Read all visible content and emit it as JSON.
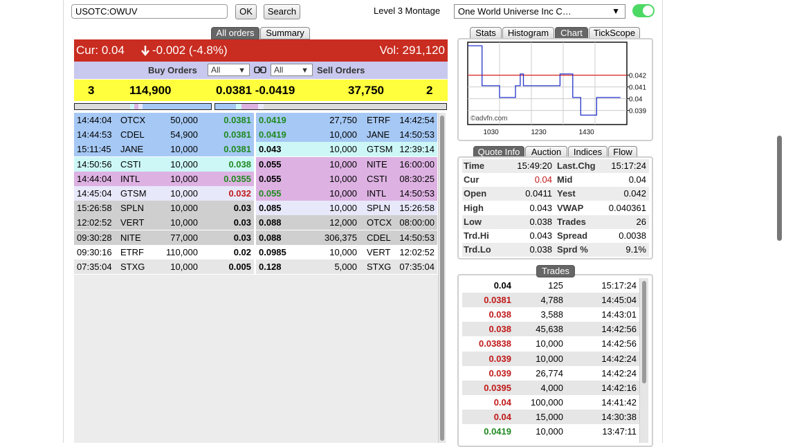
{
  "toolbar": {
    "symbol_value": "USOTC:OWUV",
    "ok_label": "OK",
    "search_label": "Search",
    "montage_label": "Level 3 Montage",
    "company_selected": "One World Universe Inc C…"
  },
  "left_tabs": [
    "All orders",
    "Summary"
  ],
  "price_bar": {
    "cur": "Cur: 0.04",
    "change": "-0.002 (-4.8%)",
    "vol": "Vol: 291,120"
  },
  "orders_header": {
    "buy_label": "Buy Orders",
    "sell_label": "Sell Orders",
    "buy_filter": "All",
    "sell_filter": "All"
  },
  "summary": {
    "buy_count": "3",
    "buy_size": "114,900",
    "spread": "0.0381 -0.0419",
    "sell_size": "37,750",
    "sell_count": "2"
  },
  "buy_orders": [
    {
      "time": "14:44:04",
      "mm": "OTCX",
      "size": "50,000",
      "price": "0.0381",
      "color": "#a6c8f4",
      "price_color": "green"
    },
    {
      "time": "14:44:53",
      "mm": "CDEL",
      "size": "54,900",
      "price": "0.0381",
      "color": "#a6c8f4",
      "price_color": "green"
    },
    {
      "time": "15:11:45",
      "mm": "JANE",
      "size": "10,000",
      "price": "0.0381",
      "color": "#a6c8f4",
      "price_color": "green"
    },
    {
      "time": "14:50:56",
      "mm": "CSTI",
      "size": "10,000",
      "price": "0.038",
      "color": "#cdf7f7",
      "price_color": "green"
    },
    {
      "time": "14:44:04",
      "mm": "INTL",
      "size": "10,000",
      "price": "0.0355",
      "color": "#ddb2e2",
      "price_color": "green"
    },
    {
      "time": "14:45:04",
      "mm": "GTSM",
      "size": "10,000",
      "price": "0.032",
      "color": "#e8e8fb",
      "price_color": "red"
    },
    {
      "time": "15:26:58",
      "mm": "SPLN",
      "size": "10,000",
      "price": "0.03",
      "color": "#cfcfcf",
      "price_color": "black"
    },
    {
      "time": "12:02:52",
      "mm": "VERT",
      "size": "10,000",
      "price": "0.03",
      "color": "#cfcfcf",
      "price_color": "black"
    },
    {
      "time": "09:30:28",
      "mm": "NITE",
      "size": "77,000",
      "price": "0.03",
      "color": "#cfcfcf",
      "price_color": "black"
    },
    {
      "time": "09:30:16",
      "mm": "ETRF",
      "size": "110,000",
      "price": "0.02",
      "color": "#ffffff",
      "price_color": "black"
    },
    {
      "time": "07:35:04",
      "mm": "STXG",
      "size": "10,000",
      "price": "0.005",
      "color": "#e6e6e6",
      "price_color": "black"
    }
  ],
  "sell_orders": [
    {
      "price": "0.0419",
      "size": "27,750",
      "mm": "ETRF",
      "time": "14:42:54",
      "color": "#a6c8f4",
      "price_color": "green"
    },
    {
      "price": "0.0419",
      "size": "10,000",
      "mm": "JANE",
      "time": "14:50:53",
      "color": "#a6c8f4",
      "price_color": "green"
    },
    {
      "price": "0.043",
      "size": "10,000",
      "mm": "GTSM",
      "time": "12:39:14",
      "color": "#cdf7f7",
      "price_color": "black"
    },
    {
      "price": "0.055",
      "size": "10,000",
      "mm": "NITE",
      "time": "16:00:00",
      "color": "#ddb2e2",
      "price_color": "black"
    },
    {
      "price": "0.055",
      "size": "10,000",
      "mm": "CSTI",
      "time": "08:30:25",
      "color": "#ddb2e2",
      "price_color": "black"
    },
    {
      "price": "0.055",
      "size": "10,000",
      "mm": "INTL",
      "time": "14:50:53",
      "color": "#ddb2e2",
      "price_color": "green"
    },
    {
      "price": "0.085",
      "size": "10,000",
      "mm": "SPLN",
      "time": "15:26:58",
      "color": "#e8e8fb",
      "price_color": "black"
    },
    {
      "price": "0.088",
      "size": "12,000",
      "mm": "OTCX",
      "time": "08:00:00",
      "color": "#cfcfcf",
      "price_color": "black"
    },
    {
      "price": "0.088",
      "size": "306,375",
      "mm": "CDEL",
      "time": "14:50:53",
      "color": "#cfcfcf",
      "price_color": "black"
    },
    {
      "price": "0.0985",
      "size": "10,000",
      "mm": "VERT",
      "time": "12:02:52",
      "color": "#ffffff",
      "price_color": "black"
    },
    {
      "price": "0.128",
      "size": "5,000",
      "mm": "STXG",
      "time": "07:35:04",
      "color": "#e6e6e6",
      "price_color": "black"
    }
  ],
  "chart_tabs": [
    "Stats",
    "Histogram",
    "Chart",
    "TickScope"
  ],
  "chart_data": {
    "type": "line",
    "x_ticks": [
      "1030",
      "1230",
      "1430"
    ],
    "y_ticks": [
      "0.042",
      "0.041",
      "0.04",
      "0.039"
    ],
    "watermark": "©advfn.com",
    "reference_line": 0.042,
    "points": [
      [
        0.0,
        0.0445
      ],
      [
        0.09,
        0.0445
      ],
      [
        0.09,
        0.0411
      ],
      [
        0.2,
        0.0411
      ],
      [
        0.2,
        0.0401
      ],
      [
        0.3,
        0.0401
      ],
      [
        0.3,
        0.0411
      ],
      [
        0.33,
        0.0411
      ],
      [
        0.33,
        0.0421
      ],
      [
        0.35,
        0.0421
      ],
      [
        0.35,
        0.0411
      ],
      [
        0.58,
        0.0411
      ],
      [
        0.58,
        0.0421
      ],
      [
        0.66,
        0.0421
      ],
      [
        0.66,
        0.0401
      ],
      [
        0.71,
        0.0401
      ],
      [
        0.71,
        0.0386
      ],
      [
        0.81,
        0.0386
      ],
      [
        0.81,
        0.0401
      ],
      [
        0.96,
        0.0401
      ]
    ]
  },
  "quote_tabs": [
    "Quote Info",
    "Auction",
    "Indices",
    "Flow"
  ],
  "quote_info": [
    {
      "l1": "Time",
      "v1": "15:49:20",
      "l2": "Last.Chg",
      "v2": "15:17:24",
      "v1_red": false
    },
    {
      "l1": "Cur",
      "v1": "0.04",
      "l2": "Mid",
      "v2": "0.04",
      "v1_red": true
    },
    {
      "l1": "Open",
      "v1": "0.0411",
      "l2": "Yest",
      "v2": "0.042",
      "v1_red": false
    },
    {
      "l1": "High",
      "v1": "0.043",
      "l2": "VWAP",
      "v2": "0.040361",
      "v1_red": false
    },
    {
      "l1": "Low",
      "v1": "0.038",
      "l2": "Trades",
      "v2": "26",
      "v1_red": false
    },
    {
      "l1": "Trd.Hi",
      "v1": "0.043",
      "l2": "Spread",
      "v2": "0.0038",
      "v1_red": false
    },
    {
      "l1": "Trd.Lo",
      "v1": "0.038",
      "l2": "Sprd %",
      "v2": "9.1%",
      "v1_red": false
    }
  ],
  "trades_label": "Trades",
  "trades": [
    {
      "price": "0.04",
      "size": "125",
      "time": "15:17:24",
      "color": "black"
    },
    {
      "price": "0.0381",
      "size": "4,788",
      "time": "14:45:04",
      "color": "red"
    },
    {
      "price": "0.038",
      "size": "3,588",
      "time": "14:43:01",
      "color": "red"
    },
    {
      "price": "0.038",
      "size": "45,638",
      "time": "14:42:56",
      "color": "red"
    },
    {
      "price": "0.03838",
      "size": "10,000",
      "time": "14:42:56",
      "color": "red"
    },
    {
      "price": "0.039",
      "size": "10,000",
      "time": "14:42:24",
      "color": "red"
    },
    {
      "price": "0.039",
      "size": "26,774",
      "time": "14:42:24",
      "color": "red"
    },
    {
      "price": "0.0395",
      "size": "4,000",
      "time": "14:42:16",
      "color": "red"
    },
    {
      "price": "0.04",
      "size": "100,000",
      "time": "14:41:42",
      "color": "red"
    },
    {
      "price": "0.04",
      "size": "15,000",
      "time": "14:30:38",
      "color": "red"
    },
    {
      "price": "0.0419",
      "size": "10,000",
      "time": "13:47:11",
      "color": "green"
    }
  ]
}
